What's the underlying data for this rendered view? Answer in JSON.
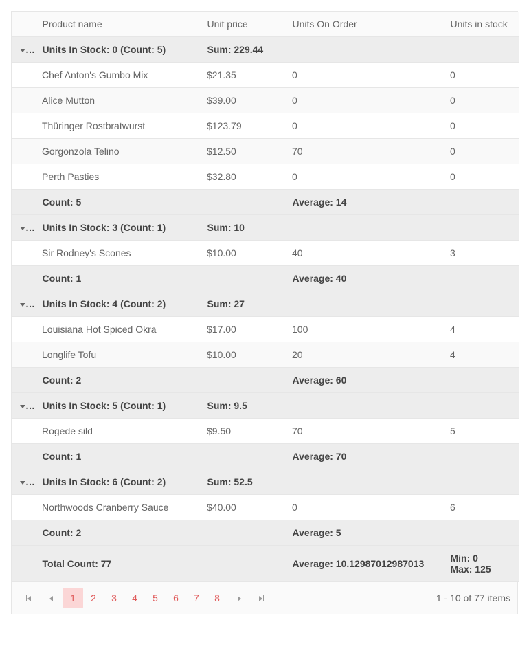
{
  "columns": {
    "expand": "",
    "name": "Product name",
    "price": "Unit price",
    "order": "Units On Order",
    "stock": "Units in stock"
  },
  "groups": [
    {
      "header": {
        "title": "Units In Stock: 0 (Count: 5)",
        "sum": "Sum: 229.44"
      },
      "rows": [
        {
          "name": "Chef Anton's Gumbo Mix",
          "price": "$21.35",
          "order": "0",
          "stock": "0"
        },
        {
          "name": "Alice Mutton",
          "price": "$39.00",
          "order": "0",
          "stock": "0"
        },
        {
          "name": "Thüringer Rostbratwurst",
          "price": "$123.79",
          "order": "0",
          "stock": "0"
        },
        {
          "name": "Gorgonzola Telino",
          "price": "$12.50",
          "order": "70",
          "stock": "0"
        },
        {
          "name": "Perth Pasties",
          "price": "$32.80",
          "order": "0",
          "stock": "0"
        }
      ],
      "footer": {
        "count": "Count: 5",
        "avg": "Average: 14"
      }
    },
    {
      "header": {
        "title": "Units In Stock: 3 (Count: 1)",
        "sum": "Sum: 10"
      },
      "rows": [
        {
          "name": "Sir Rodney's Scones",
          "price": "$10.00",
          "order": "40",
          "stock": "3"
        }
      ],
      "footer": {
        "count": "Count: 1",
        "avg": "Average: 40"
      }
    },
    {
      "header": {
        "title": "Units In Stock: 4 (Count: 2)",
        "sum": "Sum: 27"
      },
      "rows": [
        {
          "name": "Louisiana Hot Spiced Okra",
          "price": "$17.00",
          "order": "100",
          "stock": "4"
        },
        {
          "name": "Longlife Tofu",
          "price": "$10.00",
          "order": "20",
          "stock": "4"
        }
      ],
      "footer": {
        "count": "Count: 2",
        "avg": "Average: 60"
      }
    },
    {
      "header": {
        "title": "Units In Stock: 5 (Count: 1)",
        "sum": "Sum: 9.5"
      },
      "rows": [
        {
          "name": "Rogede sild",
          "price": "$9.50",
          "order": "70",
          "stock": "5"
        }
      ],
      "footer": {
        "count": "Count: 1",
        "avg": "Average: 70"
      }
    },
    {
      "header": {
        "title": "Units In Stock: 6 (Count: 2)",
        "sum": "Sum: 52.5"
      },
      "rows": [
        {
          "name": "Northwoods Cranberry Sauce",
          "price": "$40.00",
          "order": "0",
          "stock": "6"
        }
      ],
      "footer": {
        "count": "Count: 2",
        "avg": "Average: 5"
      }
    }
  ],
  "totals": {
    "count": "Total Count: 77",
    "avg": "Average: 10.12987012987013",
    "minmax": "Min: 0\nMax: 125"
  },
  "pager": {
    "pages": [
      "1",
      "2",
      "3",
      "4",
      "5",
      "6",
      "7",
      "8"
    ],
    "current": "1",
    "info": "1 - 10 of 77 items"
  }
}
